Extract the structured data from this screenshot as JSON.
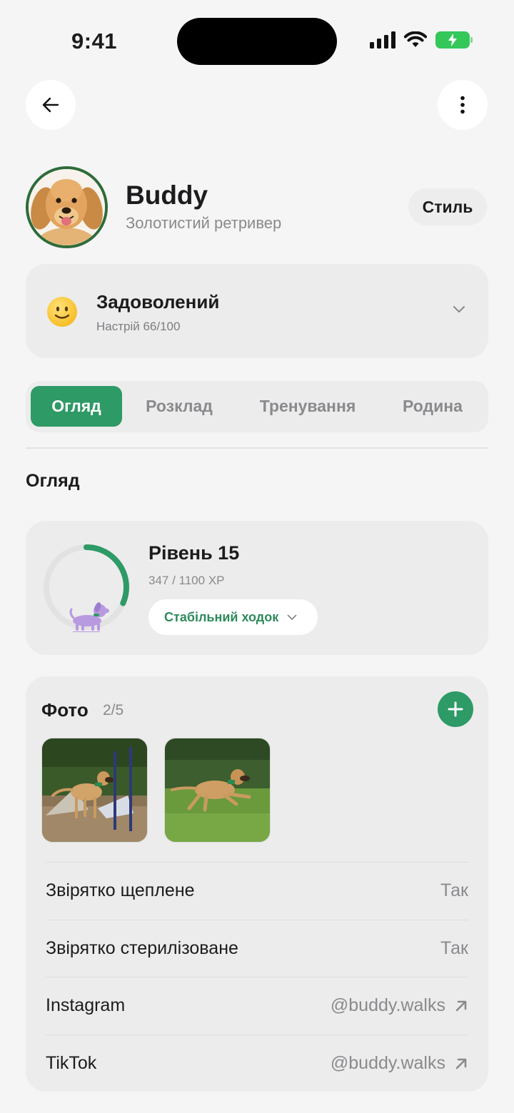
{
  "status": {
    "time": "9:41"
  },
  "profile": {
    "name": "Buddy",
    "breed": "Золотистий ретривер",
    "style_label": "Стиль"
  },
  "mood": {
    "title": "Задоволений",
    "subtitle": "Настрій 66/100",
    "value": 66
  },
  "tabs": [
    {
      "label": "Огляд",
      "active": true
    },
    {
      "label": "Розклад",
      "active": false
    },
    {
      "label": "Тренування",
      "active": false
    },
    {
      "label": "Родина",
      "active": false
    }
  ],
  "section_title": "Огляд",
  "level": {
    "title": "Рівень 15",
    "xp_text": "347 / 1100 XP",
    "xp_current": 347,
    "xp_max": 1100,
    "walker_label": "Стабільний ходок"
  },
  "photos": {
    "title": "Фото",
    "count": "2/5"
  },
  "info_rows": [
    {
      "label": "Звірятко щеплене",
      "value": "Так",
      "link": false
    },
    {
      "label": "Звірятко стерилізоване",
      "value": "Так",
      "link": false
    },
    {
      "label": "Instagram",
      "value": "@buddy.walks",
      "link": true
    },
    {
      "label": "TikTok",
      "value": "@buddy.walks",
      "link": true
    }
  ],
  "colors": {
    "accent": "#2e9a66",
    "avatar_border": "#2e6b3a",
    "battery": "#34c759",
    "walker_purple": "#b89ae0"
  }
}
